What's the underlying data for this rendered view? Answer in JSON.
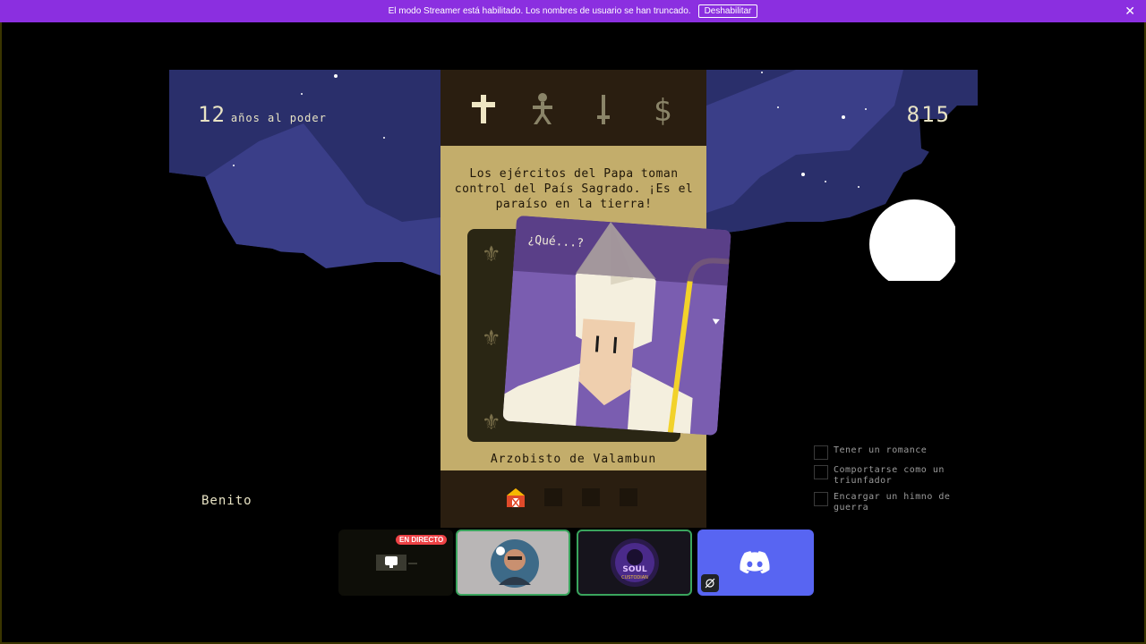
{
  "banner": {
    "message": "El modo Streamer está habilitado. Los nombres de usuario se han truncado.",
    "button_label": "Deshabilitar",
    "close_glyph": "✕",
    "color": "#8b2fe0"
  },
  "hud": {
    "years_number": "12",
    "years_label": "años al poder",
    "score": "815",
    "ruler_name": "Benito"
  },
  "stats": [
    {
      "name": "church",
      "icon": "cross-icon"
    },
    {
      "name": "people",
      "icon": "person-icon"
    },
    {
      "name": "army",
      "icon": "sword-icon"
    },
    {
      "name": "money",
      "icon": "dollar-icon"
    }
  ],
  "card": {
    "text": "Los ejércitos del Papa toman control del País Sagrado. ¡Es el paraíso en la tierra!",
    "choice_text": "¿Qué...?",
    "character_name": "Arzobisto de Valambun"
  },
  "objectives": [
    "Tener un romance",
    "Comportarse como un triunfador",
    "Encargar un himno de guerra"
  ],
  "call": {
    "live_badge": "EN DIRECTO",
    "tiles": [
      "screen-share",
      "user-avatar",
      "soul-custodian",
      "discord"
    ],
    "soul_text": "SOUL",
    "soul_subtext": "CUSTODIAN"
  },
  "colors": {
    "panel": "#c3ad6b",
    "panel_dark": "#2a1e10",
    "card_purple": "#7a5db0",
    "discord": "#5865f2",
    "sky": "#2a2f6b"
  }
}
